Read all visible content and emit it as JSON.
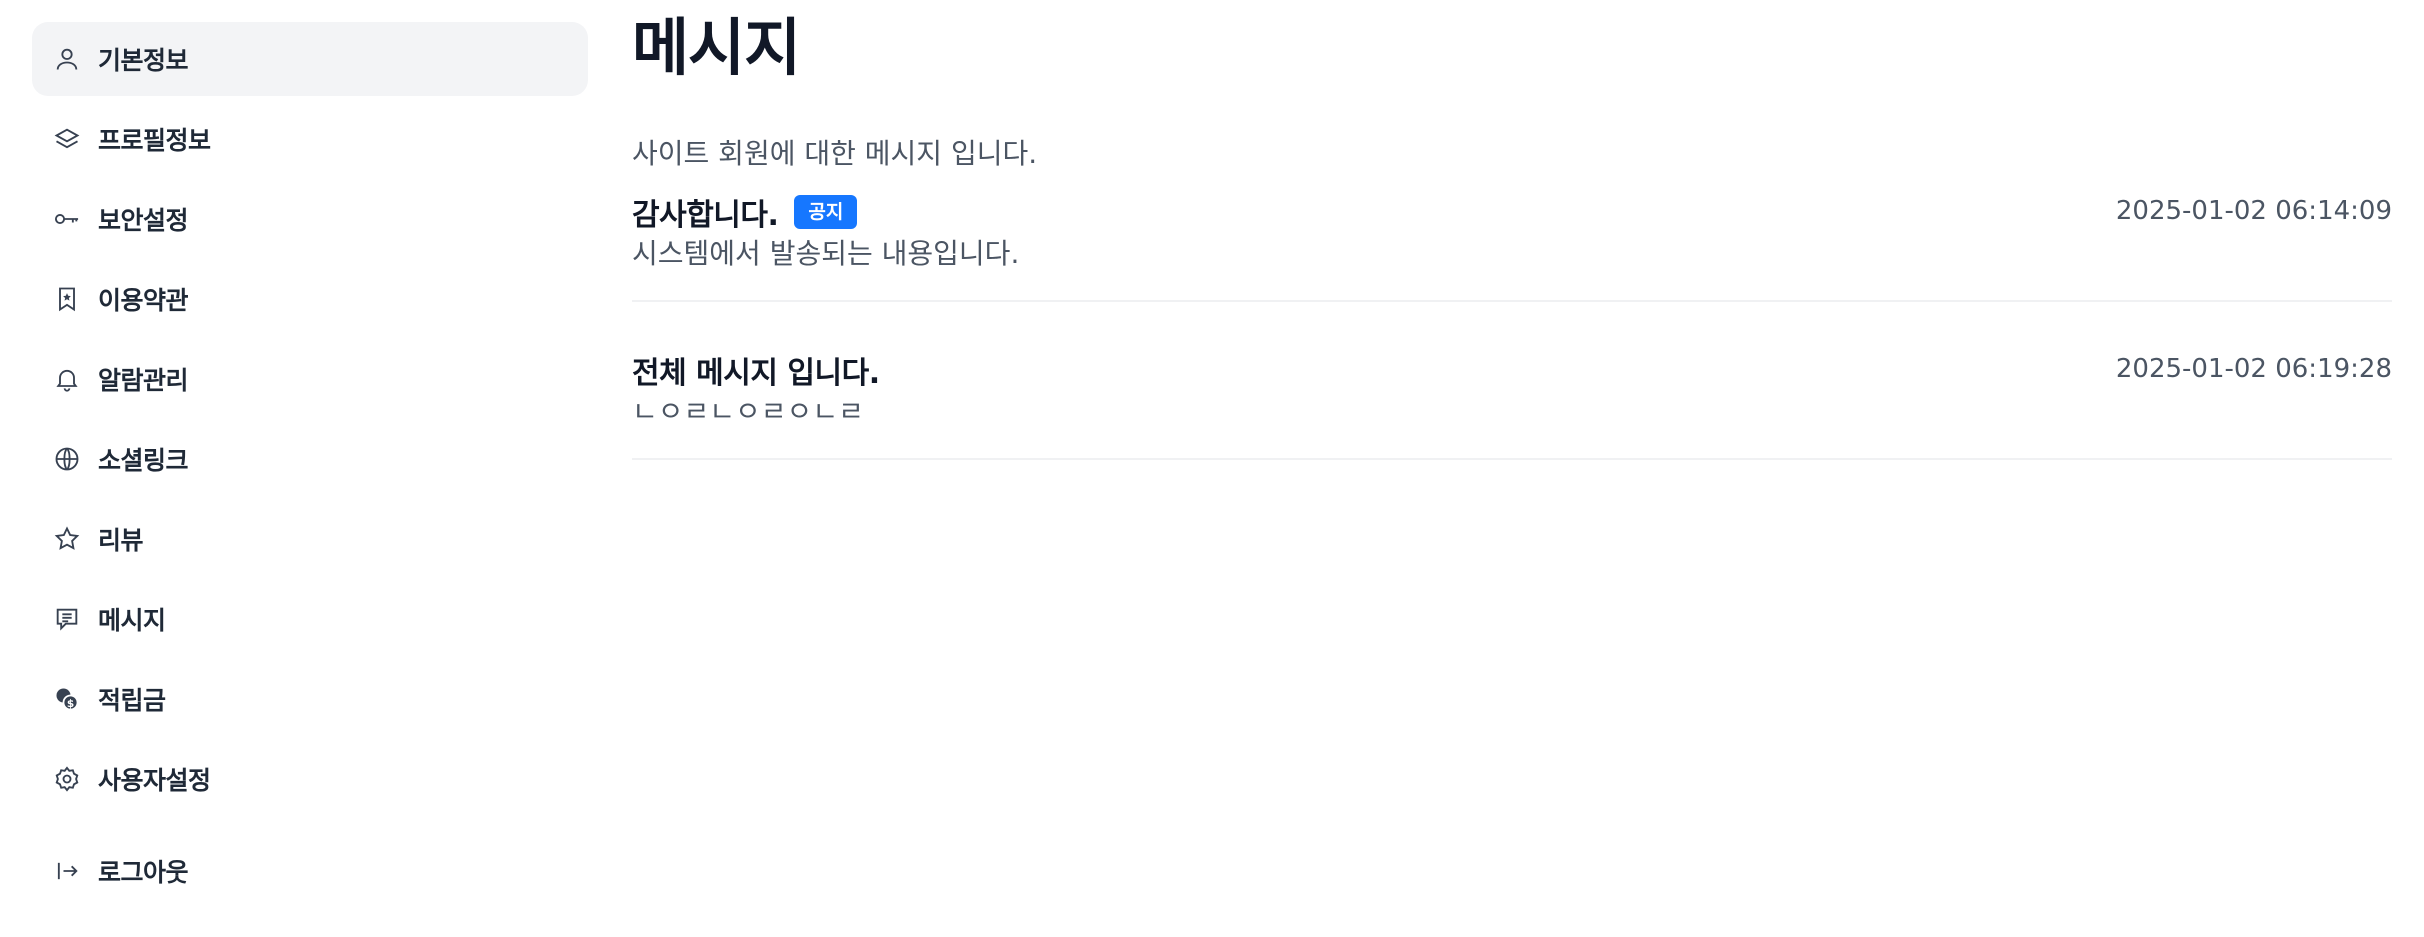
{
  "sidebar": {
    "items": [
      {
        "label": "기본정보",
        "icon": "user-icon"
      },
      {
        "label": "프로필정보",
        "icon": "layers-icon"
      },
      {
        "label": "보안설정",
        "icon": "key-icon"
      },
      {
        "label": "이용약관",
        "icon": "bookmark-star-icon"
      },
      {
        "label": "알람관리",
        "icon": "bell-icon"
      },
      {
        "label": "소셜링크",
        "icon": "globe-icon"
      },
      {
        "label": "리뷰",
        "icon": "star-icon"
      },
      {
        "label": "메시지",
        "icon": "message-icon"
      },
      {
        "label": "적립금",
        "icon": "coins-icon"
      },
      {
        "label": "사용자설정",
        "icon": "gear-icon"
      }
    ],
    "logout": {
      "label": "로그아웃",
      "icon": "logout-icon"
    }
  },
  "main": {
    "title": "메시지",
    "description": "사이트 회원에 대한 메시지 입니다.",
    "messages": [
      {
        "title": "감사합니다.",
        "badge": "공지",
        "date": "2025-01-02 06:14:09",
        "body": "시스템에서 발송되는 내용입니다."
      },
      {
        "title": "전체 메시지 입니다.",
        "date": "2025-01-02 06:19:28",
        "body": "ㄴㅇㄹㄴㅇㄹㅇㄴㄹ"
      }
    ]
  },
  "colors": {
    "accent": "#1677ff",
    "active_bg": "#f3f4f6"
  }
}
